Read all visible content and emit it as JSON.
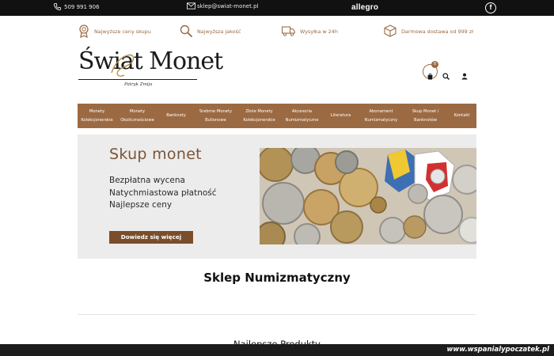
{
  "topbar": {
    "phone": "509 991 906",
    "email": "sklep@swiat-monet.pl",
    "marketplace": "allegro",
    "social_icon": "facebook-icon"
  },
  "features": [
    {
      "icon": "medal-icon",
      "label": "Najwyższe ceny skupu"
    },
    {
      "icon": "magnifier-icon",
      "label": "Najwyższa jakość"
    },
    {
      "icon": "truck-icon",
      "label": "Wysyłka w 24h"
    },
    {
      "icon": "box-icon",
      "label": "Darmowa dostawa od 999 zł"
    }
  ],
  "logo": {
    "text": "Świat Monet",
    "subtitle": "Patryk Zmija"
  },
  "header": {
    "cart_count": "0",
    "cart_icon": "cart-icon",
    "search_icon": "search-icon",
    "user_icon": "user-icon"
  },
  "nav": [
    {
      "line1": "Monety",
      "line2": "Kolekcjonerskie"
    },
    {
      "line1": "Monety",
      "line2": "Okolicznościowe"
    },
    {
      "line1": "Banknoty",
      "line2": ""
    },
    {
      "line1": "Srebrne Monety",
      "line2": "Bulionowe"
    },
    {
      "line1": "Złote Monety",
      "line2": "Kolekcjonerskie"
    },
    {
      "line1": "Akcesoria",
      "line2": "Numizmatyczne"
    },
    {
      "line1": "Literatura",
      "line2": ""
    },
    {
      "line1": "Abonament",
      "line2": "Numizmatyczny"
    },
    {
      "line1": "Skup Monet i",
      "line2": "Banknotów"
    },
    {
      "line1": "Kontakt",
      "line2": ""
    }
  ],
  "banner": {
    "title": "Skup monet",
    "lines": [
      "Bezpłatna wycena",
      "Natychmiastowa płatność",
      "Najlepsze ceny"
    ],
    "cta": "Dowiedz się więcej"
  },
  "sections": {
    "shop_heading": "Sklep Numizmatyczny",
    "best_products": "Najlepsze Produkty"
  },
  "watermark": "www.wspanialypoczatek.pl",
  "colors": {
    "accent": "#9c6a42",
    "topbar": "#111111",
    "banner_bg": "#ececec",
    "cta": "#7a4e2a"
  }
}
